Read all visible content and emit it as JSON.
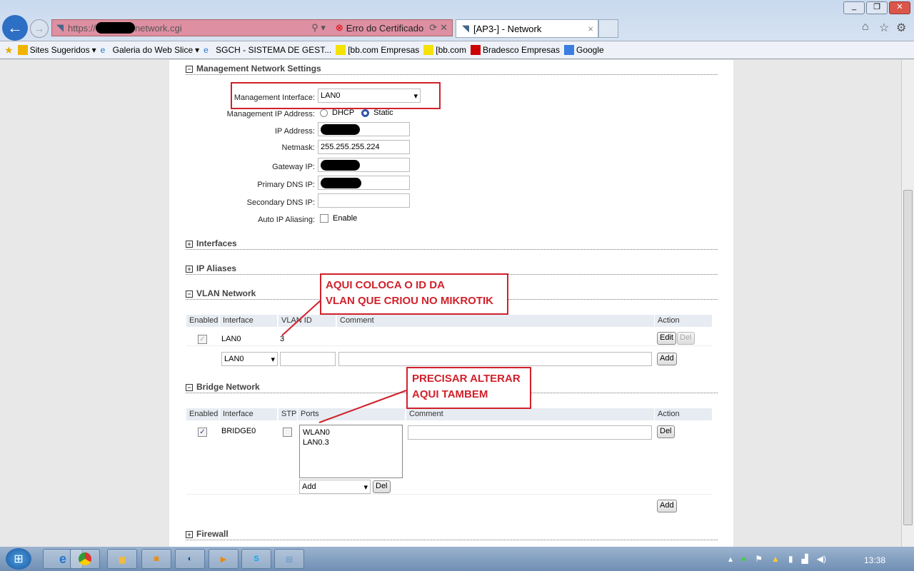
{
  "browser": {
    "url_prefix": "https://",
    "url_suffix": "network.cgi",
    "cert_error": "Erro do Certificado",
    "tab_title": "[AP3-] - Network",
    "favorites": [
      "Sites Sugeridos",
      "Galeria do Web Slice",
      "SGCH - SISTEMA DE GEST...",
      "[bb.com Empresas",
      "[bb.com",
      "Bradesco Empresas",
      "Google"
    ]
  },
  "mgmt": {
    "title": "Management Network Settings",
    "interface_label": "Management Interface:",
    "interface_value": "LAN0",
    "ip_mode_label": "Management IP Address:",
    "dhcp": "DHCP",
    "static": "Static",
    "ip_label": "IP Address:",
    "netmask_label": "Netmask:",
    "netmask": "255.255.255.224",
    "gateway_label": "Gateway IP:",
    "dns1_label": "Primary DNS IP:",
    "dns2_label": "Secondary DNS IP:",
    "alias_label": "Auto IP Aliasing:",
    "alias_enable": "Enable"
  },
  "sections": {
    "interfaces": "Interfaces",
    "ip_aliases": "IP Aliases",
    "vlan": "VLAN Network",
    "bridge": "Bridge Network",
    "firewall": "Firewall"
  },
  "vlan": {
    "headers": [
      "Enabled",
      "Interface",
      "VLAN ID",
      "Comment",
      "Action"
    ],
    "row": {
      "interface": "LAN0",
      "id": "3"
    },
    "new_interface": "LAN0",
    "edit": "Edit",
    "del": "Del",
    "add": "Add"
  },
  "bridge": {
    "headers": [
      "Enabled",
      "Interface",
      "STP",
      "Ports",
      "Comment",
      "Action"
    ],
    "row": {
      "interface": "BRIDGE0",
      "ports": [
        "WLAN0",
        "LAN0.3"
      ]
    },
    "add_select": "Add",
    "del": "Del",
    "add": "Add"
  },
  "annotations": {
    "vlan_note_1": "AQUI COLOCA O ID DA",
    "vlan_note_2": "VLAN QUE CRIOU NO MIKROTIK",
    "bridge_note_1": "PRECISAR ALTERAR",
    "bridge_note_2": "AQUI TAMBEM"
  },
  "clock": "13:38"
}
